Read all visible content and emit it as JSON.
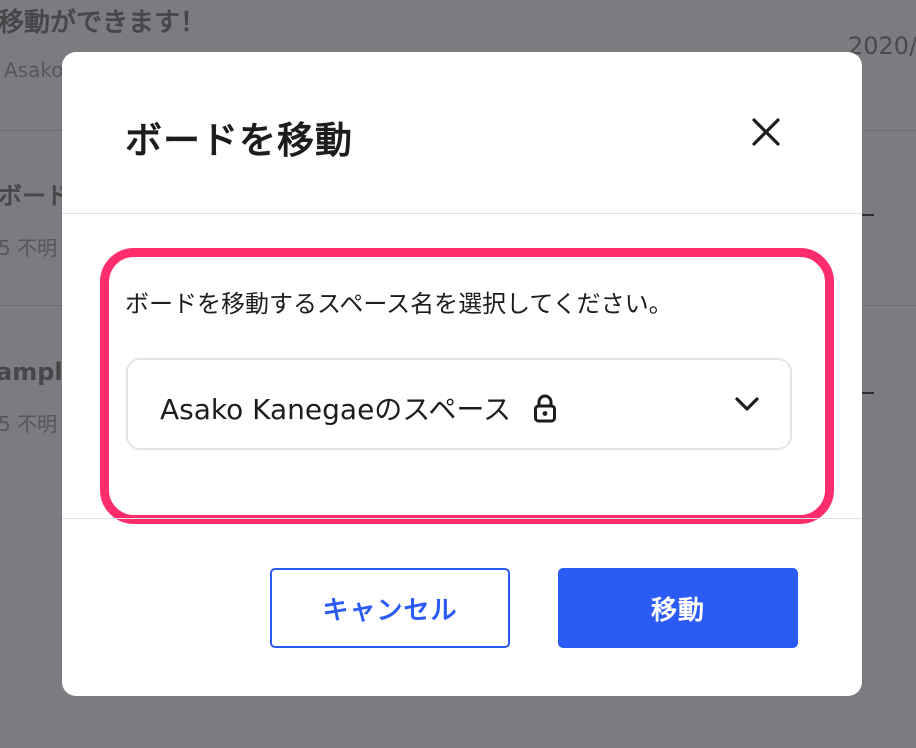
{
  "background": {
    "row1_title": "移動ができます！",
    "row1_sub": "Asako",
    "row1_date": "2020/",
    "row2_title": "ボード",
    "row2_sub": "5 不明",
    "row3_title": "ample",
    "row3_sub": "5 不明"
  },
  "modal": {
    "title": "ボードを移動",
    "close_icon": "close-icon",
    "instruction": "ボードを移動するスペース名を選択してください。",
    "select": {
      "value": "Asako Kanegaeのスペース",
      "lock_icon": "lock-icon",
      "chevron_icon": "chevron-down-icon"
    },
    "cancel_label": "キャンセル",
    "move_label": "移動"
  },
  "colors": {
    "accent": "#2b5bf5",
    "highlight": "#ff2d6c",
    "overlay": "#7b7b80"
  }
}
